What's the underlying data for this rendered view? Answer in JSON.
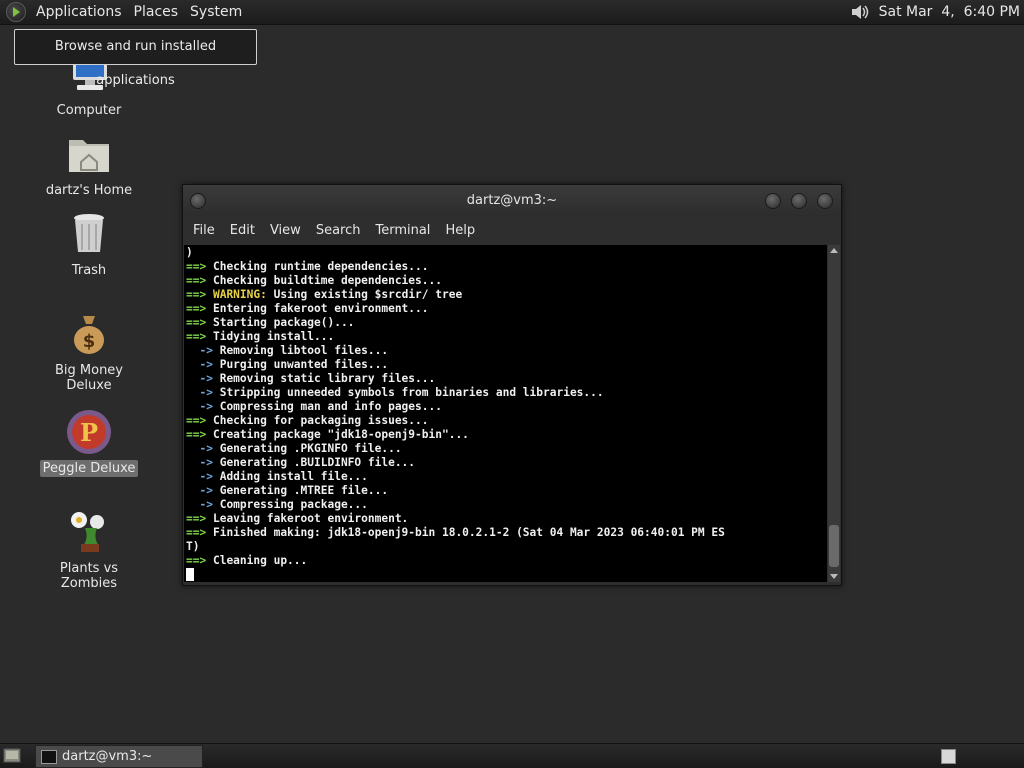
{
  "top_panel": {
    "menus": [
      "Applications",
      "Places",
      "System"
    ],
    "clock": "Sat Mar  4,  6:40 PM"
  },
  "tooltip": "Browse and run installed applications",
  "desktop_icons": [
    {
      "label": "Computer"
    },
    {
      "label": "dartz's Home"
    },
    {
      "label": "Trash"
    },
    {
      "label": "Big Money Deluxe"
    },
    {
      "label": "Peggle Deluxe",
      "selected": true
    },
    {
      "label": "Plants vs Zombies"
    }
  ],
  "terminal": {
    "title": "dartz@vm3:~",
    "menus": [
      "File",
      "Edit",
      "View",
      "Search",
      "Terminal",
      "Help"
    ],
    "lines": [
      {
        "arrow": "",
        "text": ")"
      },
      {
        "arrow": "==>",
        "text": "Checking runtime dependencies..."
      },
      {
        "arrow": "==>",
        "text": "Checking buildtime dependencies..."
      },
      {
        "arrow": "==>",
        "warn": "WARNING:",
        "text": "Using existing $srcdir/ tree"
      },
      {
        "arrow": "==>",
        "text": "Entering fakeroot environment..."
      },
      {
        "arrow": "==>",
        "text": "Starting package()..."
      },
      {
        "arrow": "==>",
        "text": "Tidying install..."
      },
      {
        "arrow": "  ->",
        "text": "Removing libtool files..."
      },
      {
        "arrow": "  ->",
        "text": "Purging unwanted files..."
      },
      {
        "arrow": "  ->",
        "text": "Removing static library files..."
      },
      {
        "arrow": "  ->",
        "text": "Stripping unneeded symbols from binaries and libraries..."
      },
      {
        "arrow": "  ->",
        "text": "Compressing man and info pages..."
      },
      {
        "arrow": "==>",
        "text": "Checking for packaging issues..."
      },
      {
        "arrow": "==>",
        "text": "Creating package \"jdk18-openj9-bin\"..."
      },
      {
        "arrow": "  ->",
        "text": "Generating .PKGINFO file..."
      },
      {
        "arrow": "  ->",
        "text": "Generating .BUILDINFO file..."
      },
      {
        "arrow": "  ->",
        "text": "Adding install file..."
      },
      {
        "arrow": "  ->",
        "text": "Generating .MTREE file..."
      },
      {
        "arrow": "  ->",
        "text": "Compressing package..."
      },
      {
        "arrow": "==>",
        "text": "Leaving fakeroot environment."
      },
      {
        "arrow": "==>",
        "text": "Finished making: jdk18-openj9-bin 18.0.2.1-2 (Sat 04 Mar 2023 06:40:01 PM ES"
      },
      {
        "arrow": "",
        "text": "T)"
      },
      {
        "arrow": "==>",
        "text": "Cleaning up..."
      }
    ]
  },
  "taskbar": {
    "task_label": "dartz@vm3:~"
  },
  "colors": {
    "prompt_arrow": "#7fd84a",
    "sub_arrow": "#6fa8dc",
    "warning": "#e8d24a",
    "terminal_bg": "#000000",
    "desktop_bg": "#2b2b2b"
  },
  "icons": [
    "menu-logo-icon",
    "volume-icon",
    "computer-icon",
    "home-folder-icon",
    "trash-icon",
    "money-bag-icon",
    "peggle-icon",
    "plants-icon",
    "show-desktop-icon",
    "terminal-icon",
    "workspace-switcher-icon"
  ]
}
